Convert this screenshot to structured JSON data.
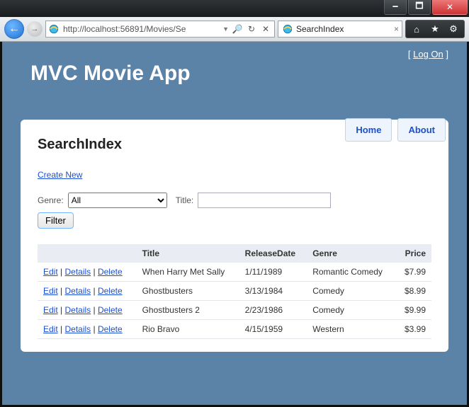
{
  "window": {
    "min": "🗕",
    "max": "🗖",
    "close": "✕"
  },
  "browser": {
    "url": "http://localhost:56891/Movies/Se",
    "tab_title": "SearchIndex",
    "back_glyph": "←",
    "fwd_glyph": "→",
    "search_glyph": "🔍",
    "refresh_glyph": "↻",
    "stop_glyph": "✕",
    "tab_close": "×",
    "home_glyph": "⌂",
    "fav_glyph": "★",
    "gear_glyph": "⚙"
  },
  "logon": {
    "left": "[ ",
    "label": "Log On",
    "right": " ]"
  },
  "app_title": "MVC Movie App",
  "nav": {
    "home": "Home",
    "about": "About"
  },
  "page": {
    "heading": "SearchIndex",
    "create_new": "Create New",
    "genre_label": "Genre:",
    "genre_value": "All",
    "title_label": "Title:",
    "title_value": "",
    "filter_btn": "Filter"
  },
  "table": {
    "headers": {
      "actions": "",
      "title": "Title",
      "date": "ReleaseDate",
      "genre": "Genre",
      "price": "Price"
    },
    "action_labels": {
      "edit": "Edit",
      "details": "Details",
      "delete": "Delete"
    },
    "sep": " | ",
    "rows": [
      {
        "title": "When Harry Met Sally",
        "date": "1/11/1989",
        "genre": "Romantic Comedy",
        "price": "$7.99"
      },
      {
        "title": "Ghostbusters",
        "date": "3/13/1984",
        "genre": "Comedy",
        "price": "$8.99"
      },
      {
        "title": "Ghostbusters 2",
        "date": "2/23/1986",
        "genre": "Comedy",
        "price": "$9.99"
      },
      {
        "title": "Rio Bravo",
        "date": "4/15/1959",
        "genre": "Western",
        "price": "$3.99"
      }
    ]
  }
}
